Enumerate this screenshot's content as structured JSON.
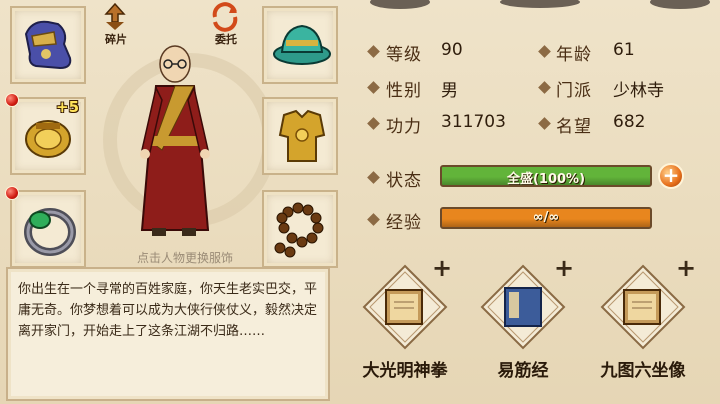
{
  "top_actions": {
    "fragments_label": "碎片",
    "delegate_label": "委托"
  },
  "equipment": {
    "left": [
      {
        "icon": "boots-icon",
        "badge": "",
        "alert": false
      },
      {
        "icon": "armguard-icon",
        "badge": "+5",
        "alert": true
      },
      {
        "icon": "jade-ring-icon",
        "badge": "",
        "alert": true
      }
    ],
    "right": [
      {
        "icon": "hat-icon",
        "badge": "",
        "alert": false
      },
      {
        "icon": "armor-icon",
        "badge": "",
        "alert": false
      },
      {
        "icon": "prayer-beads-icon",
        "badge": "",
        "alert": false
      }
    ]
  },
  "character": {
    "hint": "点击人物更换服饰"
  },
  "bio": "你出生在一个寻常的百姓家庭，你天生老实巴交，平庸无奇。你梦想着可以成为大侠行侠仗义，毅然决定离开家门，开始走上了这条江湖不归路……",
  "stats": {
    "level_label": "等级",
    "level_value": "90",
    "age_label": "年龄",
    "age_value": "61",
    "gender_label": "性别",
    "gender_value": "男",
    "sect_label": "门派",
    "sect_value": "少林寺",
    "power_label": "功力",
    "power_value": "311703",
    "fame_label": "名望",
    "fame_value": "682"
  },
  "status": {
    "label": "状态",
    "text": "全盛(100%)",
    "fill": 1.0,
    "color": "#62b43a"
  },
  "experience": {
    "label": "经验",
    "text": "∞/∞",
    "fill": 1.0,
    "color": "#e8861e"
  },
  "skills": [
    {
      "name": "大光明神拳",
      "icon": "scroll-book-icon"
    },
    {
      "name": "易筋经",
      "icon": "blue-manual-icon"
    },
    {
      "name": "九图六坐像",
      "icon": "scroll-book-icon"
    }
  ],
  "skill_add_symbol": "+",
  "status_add_symbol": "+"
}
